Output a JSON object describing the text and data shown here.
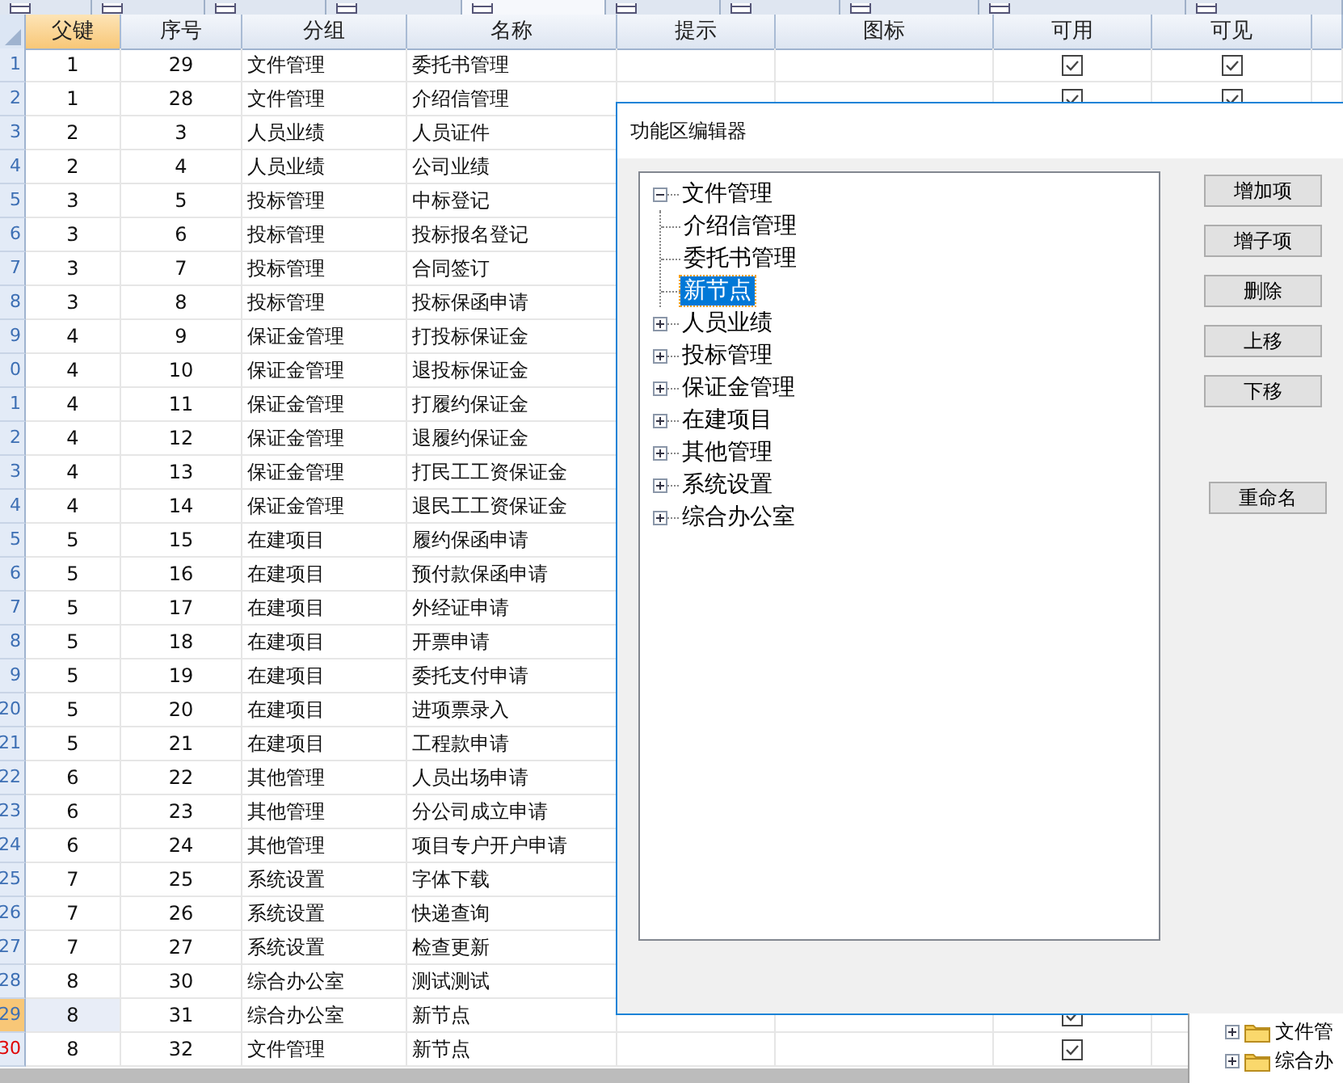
{
  "tabs": [
    {
      "selected": false
    },
    {
      "selected": false
    },
    {
      "selected": false
    },
    {
      "selected": false
    },
    {
      "selected": true
    },
    {
      "selected": false
    },
    {
      "selected": false
    },
    {
      "selected": false
    },
    {
      "selected": false
    },
    {
      "selected": false
    }
  ],
  "table": {
    "columns": [
      "父键",
      "序号",
      "分组",
      "名称",
      "提示",
      "图标",
      "可用",
      "可见"
    ],
    "rows": [
      {
        "number": "1",
        "selected": false,
        "modified": false,
        "cells": [
          "1",
          "29",
          "文件管理",
          "委托书管理"
        ],
        "enabled": true,
        "visible": true
      },
      {
        "number": "2",
        "selected": false,
        "modified": false,
        "cells": [
          "1",
          "28",
          "文件管理",
          "介绍信管理"
        ],
        "enabled": true,
        "visible": true
      },
      {
        "number": "3",
        "selected": false,
        "modified": false,
        "cells": [
          "2",
          "3",
          "人员业绩",
          "人员证件"
        ]
      },
      {
        "number": "4",
        "selected": false,
        "modified": false,
        "cells": [
          "2",
          "4",
          "人员业绩",
          "公司业绩"
        ]
      },
      {
        "number": "5",
        "selected": false,
        "modified": false,
        "cells": [
          "3",
          "5",
          "投标管理",
          "中标登记"
        ]
      },
      {
        "number": "6",
        "selected": false,
        "modified": false,
        "cells": [
          "3",
          "6",
          "投标管理",
          "投标报名登记"
        ]
      },
      {
        "number": "7",
        "selected": false,
        "modified": false,
        "cells": [
          "3",
          "7",
          "投标管理",
          "合同签订"
        ]
      },
      {
        "number": "8",
        "selected": false,
        "modified": false,
        "cells": [
          "3",
          "8",
          "投标管理",
          "投标保函申请"
        ]
      },
      {
        "number": "9",
        "selected": false,
        "modified": false,
        "cells": [
          "4",
          "9",
          "保证金管理",
          "打投标保证金"
        ]
      },
      {
        "number": "0",
        "selected": false,
        "modified": false,
        "cells": [
          "4",
          "10",
          "保证金管理",
          "退投标保证金"
        ]
      },
      {
        "number": "1",
        "selected": false,
        "modified": false,
        "cells": [
          "4",
          "11",
          "保证金管理",
          "打履约保证金"
        ]
      },
      {
        "number": "2",
        "selected": false,
        "modified": false,
        "cells": [
          "4",
          "12",
          "保证金管理",
          "退履约保证金"
        ]
      },
      {
        "number": "3",
        "selected": false,
        "modified": false,
        "cells": [
          "4",
          "13",
          "保证金管理",
          "打民工工资保证金"
        ]
      },
      {
        "number": "4",
        "selected": false,
        "modified": false,
        "cells": [
          "4",
          "14",
          "保证金管理",
          "退民工工资保证金"
        ]
      },
      {
        "number": "5",
        "selected": false,
        "modified": false,
        "cells": [
          "5",
          "15",
          "在建项目",
          "履约保函申请"
        ]
      },
      {
        "number": "6",
        "selected": false,
        "modified": false,
        "cells": [
          "5",
          "16",
          "在建项目",
          "预付款保函申请"
        ]
      },
      {
        "number": "7",
        "selected": false,
        "modified": false,
        "cells": [
          "5",
          "17",
          "在建项目",
          "外经证申请"
        ]
      },
      {
        "number": "8",
        "selected": false,
        "modified": false,
        "cells": [
          "5",
          "18",
          "在建项目",
          "开票申请"
        ]
      },
      {
        "number": "9",
        "selected": false,
        "modified": false,
        "cells": [
          "5",
          "19",
          "在建项目",
          "委托支付申请"
        ]
      },
      {
        "number": "20",
        "selected": false,
        "modified": false,
        "cells": [
          "5",
          "20",
          "在建项目",
          "进项票录入"
        ]
      },
      {
        "number": "21",
        "selected": false,
        "modified": false,
        "cells": [
          "5",
          "21",
          "在建项目",
          "工程款申请"
        ]
      },
      {
        "number": "22",
        "selected": false,
        "modified": false,
        "cells": [
          "6",
          "22",
          "其他管理",
          "人员出场申请"
        ]
      },
      {
        "number": "23",
        "selected": false,
        "modified": false,
        "cells": [
          "6",
          "23",
          "其他管理",
          "分公司成立申请"
        ]
      },
      {
        "number": "24",
        "selected": false,
        "modified": false,
        "cells": [
          "6",
          "24",
          "其他管理",
          "项目专户开户申请"
        ]
      },
      {
        "number": "25",
        "selected": false,
        "modified": false,
        "cells": [
          "7",
          "25",
          "系统设置",
          "字体下载"
        ]
      },
      {
        "number": "26",
        "selected": false,
        "modified": false,
        "cells": [
          "7",
          "26",
          "系统设置",
          "快递查询"
        ]
      },
      {
        "number": "27",
        "selected": false,
        "modified": false,
        "cells": [
          "7",
          "27",
          "系统设置",
          "检查更新"
        ]
      },
      {
        "number": "28",
        "selected": false,
        "modified": false,
        "cells": [
          "8",
          "30",
          "综合办公室",
          "测试测试"
        ]
      },
      {
        "number": "29",
        "selected": true,
        "modified": false,
        "cells": [
          "8",
          "31",
          "综合办公室",
          "新节点"
        ],
        "enabled": true
      },
      {
        "number": "30",
        "selected": false,
        "modified": true,
        "cells": [
          "8",
          "32",
          "文件管理",
          "新节点"
        ],
        "enabled": true
      }
    ]
  },
  "dialog": {
    "title": "功能区编辑器",
    "tree": [
      {
        "label": "文件管理",
        "expanded": true,
        "selected": false,
        "children": [
          {
            "label": "介绍信管理",
            "selected": false
          },
          {
            "label": "委托书管理",
            "selected": false
          },
          {
            "label": "新节点",
            "selected": true
          }
        ]
      },
      {
        "label": "人员业绩",
        "expanded": false,
        "selected": false
      },
      {
        "label": "投标管理",
        "expanded": false,
        "selected": false
      },
      {
        "label": "保证金管理",
        "expanded": false,
        "selected": false
      },
      {
        "label": "在建项目",
        "expanded": false,
        "selected": false
      },
      {
        "label": "其他管理",
        "expanded": false,
        "selected": false
      },
      {
        "label": "系统设置",
        "expanded": false,
        "selected": false
      },
      {
        "label": "综合办公室",
        "expanded": false,
        "selected": false
      }
    ],
    "buttons": [
      "增加项",
      "增子项",
      "删除",
      "上移",
      "下移"
    ],
    "rename_button": "重命名"
  },
  "side_tree": [
    {
      "label": "文件管",
      "expanded": false
    },
    {
      "label": "综合办",
      "expanded": false
    }
  ]
}
